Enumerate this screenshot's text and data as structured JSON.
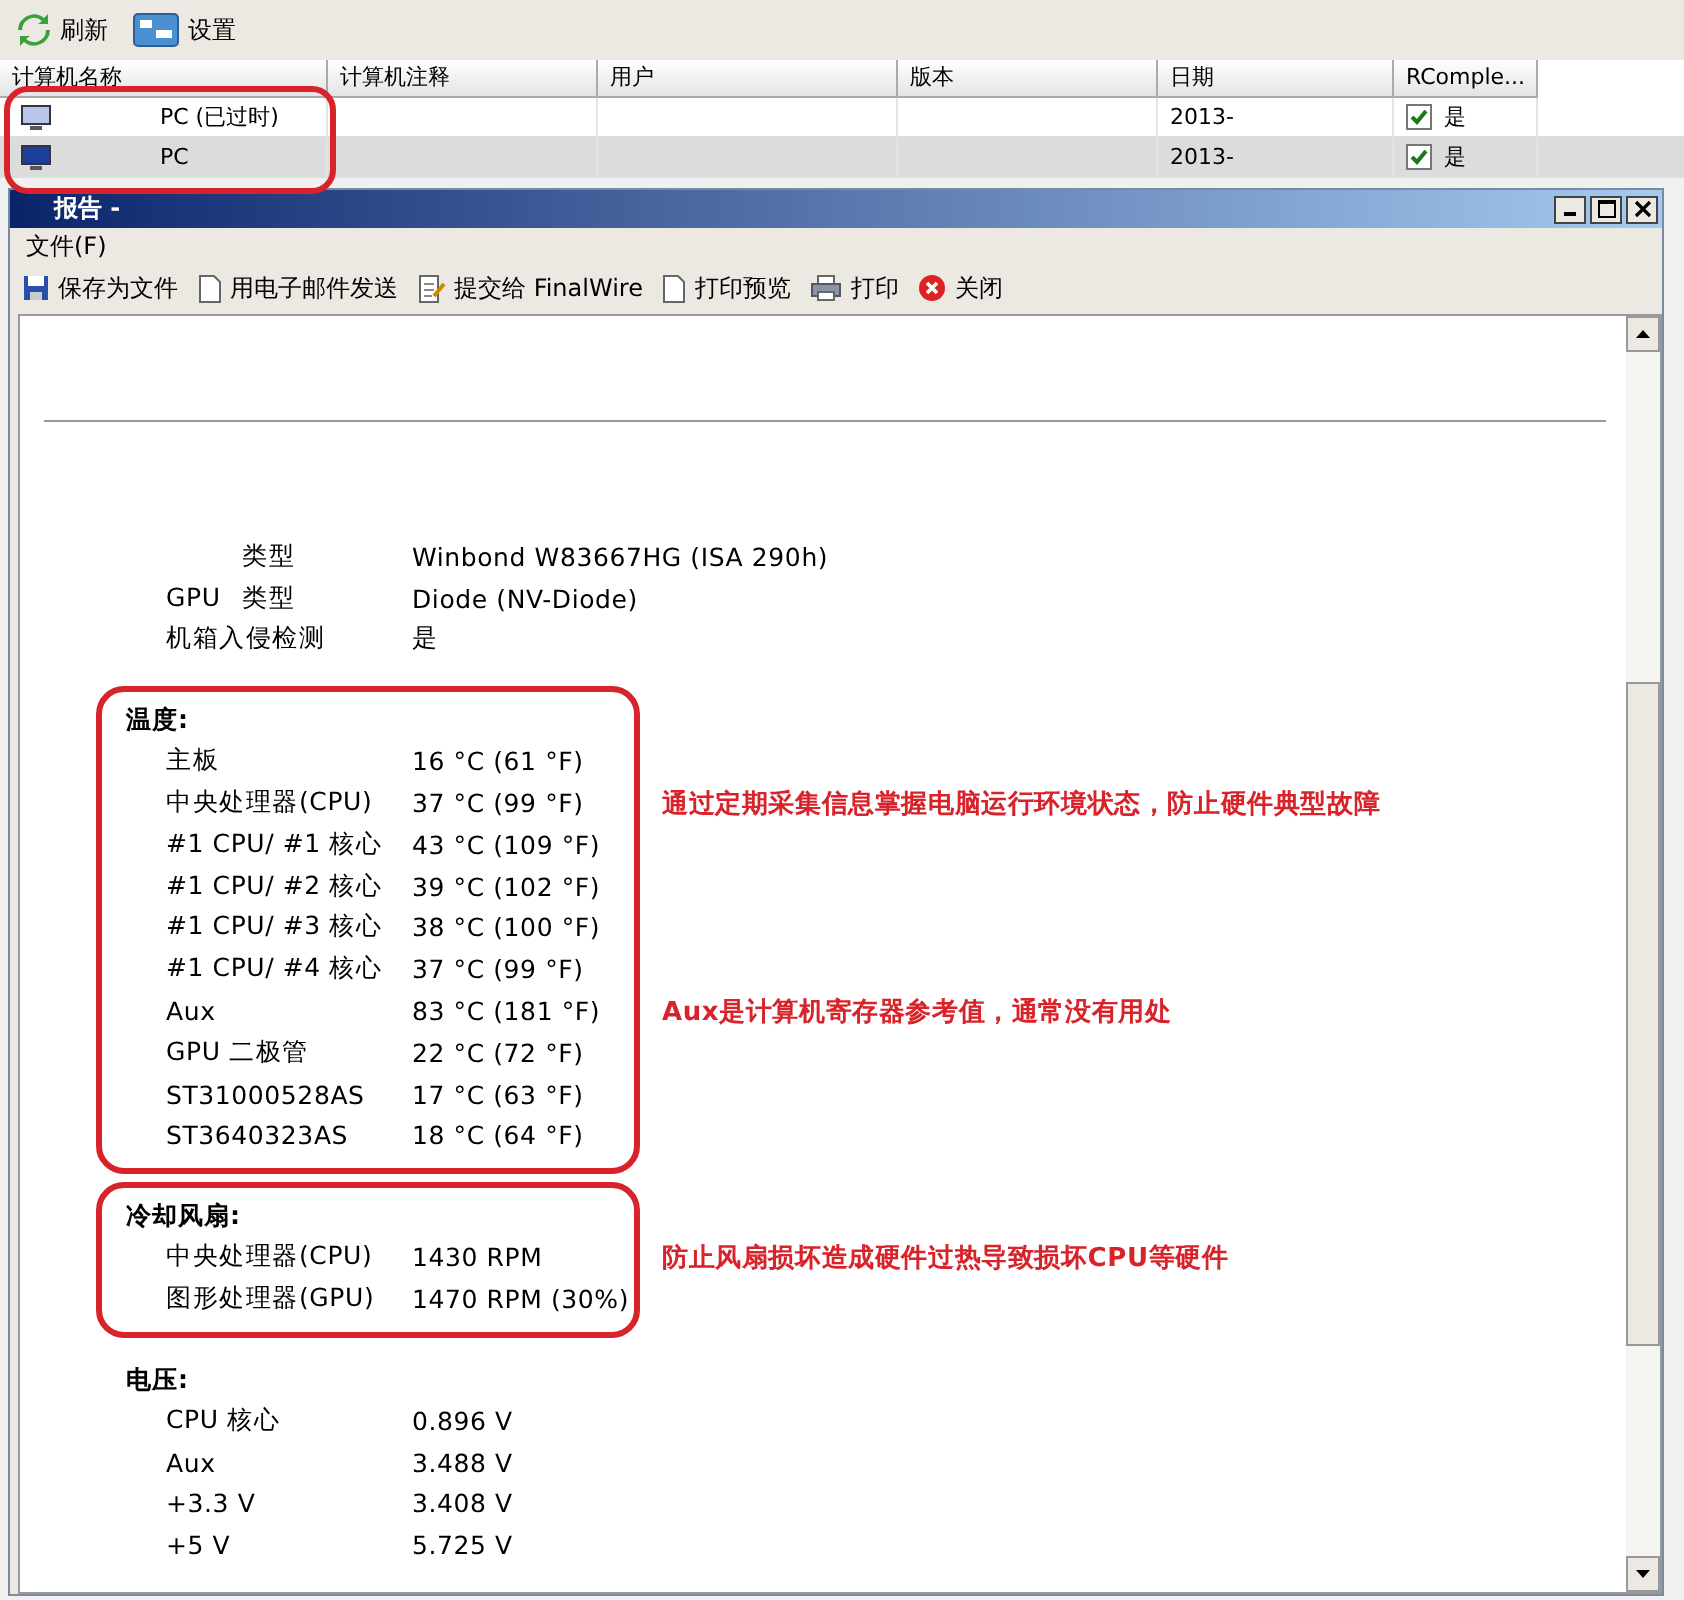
{
  "toolbar": [
    {
      "label": "刷新"
    },
    {
      "label": "设置"
    }
  ],
  "table": {
    "columns": [
      "计算机名称",
      "计算机注释",
      "用户",
      "版本",
      "日期",
      "RComple..."
    ],
    "rows": [
      {
        "name": "PC (已过时)",
        "date": "2013-",
        "checked": true,
        "flag": "是",
        "selected": false,
        "outdated": true
      },
      {
        "name": "PC",
        "date": "2013-",
        "checked": true,
        "flag": "是",
        "selected": true,
        "outdated": false
      }
    ],
    "annotated": true
  },
  "report": {
    "title": "报告 -",
    "menu": [
      "文件(F)"
    ],
    "actions": [
      {
        "label": "保存为文件"
      },
      {
        "label": "用电子邮件发送"
      },
      {
        "label": "提交给 FinalWire"
      },
      {
        "label": "打印预览"
      },
      {
        "label": "打印"
      },
      {
        "label": "关闭"
      }
    ],
    "sections": [
      {
        "rows": [
          {
            "kind": "sub",
            "label": "类型",
            "value": "Winbond W83667HG (ISA 290h)"
          },
          {
            "kind": "sub",
            "prefix": "GPU",
            "label": "类型",
            "value": "Diode (NV-Diode)"
          },
          {
            "kind": "plain",
            "label": "机箱入侵检测",
            "value": "是"
          }
        ]
      },
      {
        "title": "温度:",
        "annotated": true,
        "rows": [
          {
            "kind": "plain",
            "label": "主板",
            "value": "16 °C (61 °F)"
          },
          {
            "kind": "plain",
            "label": "中央处理器(CPU)",
            "value": "37 °C (99 °F)",
            "note": "通过定期采集信息掌握电脑运行环境状态，防止硬件典型故障"
          },
          {
            "kind": "plain",
            "label": "#1 CPU/ #1 核心",
            "value": "43 °C (109 °F)"
          },
          {
            "kind": "plain",
            "label": "#1 CPU/ #2 核心",
            "value": "39 °C (102 °F)"
          },
          {
            "kind": "plain",
            "label": "#1 CPU/ #3 核心",
            "value": "38 °C (100 °F)"
          },
          {
            "kind": "plain",
            "label": "#1 CPU/ #4 核心",
            "value": "37 °C (99 °F)"
          },
          {
            "kind": "plain",
            "label": "Aux",
            "value": "83 °C (181 °F)",
            "note": "Aux是计算机寄存器参考值，通常没有用处"
          },
          {
            "kind": "plain",
            "label": "GPU 二极管",
            "value": "22 °C (72 °F)"
          },
          {
            "kind": "plain",
            "label": "ST31000528AS",
            "value": "17 °C (63 °F)"
          },
          {
            "kind": "plain",
            "label": "ST3640323AS",
            "value": "18 °C (64 °F)"
          }
        ]
      },
      {
        "title": "冷却风扇:",
        "annotated": true,
        "rows": [
          {
            "kind": "plain",
            "label": "中央处理器(CPU)",
            "value": "1430 RPM",
            "note": "防止风扇损坏造成硬件过热导致损坏CPU等硬件"
          },
          {
            "kind": "plain",
            "label": "图形处理器(GPU)",
            "value": "1470 RPM (30%)"
          }
        ]
      },
      {
        "title": "电压:",
        "rows": [
          {
            "kind": "plain",
            "label": "CPU 核心",
            "value": "0.896 V"
          },
          {
            "kind": "plain",
            "label": "Aux",
            "value": "3.488 V"
          },
          {
            "kind": "plain",
            "label": "+3.3 V",
            "value": "3.408 V"
          },
          {
            "kind": "plain",
            "label": "+5 V",
            "value": "5.725 V"
          }
        ]
      }
    ]
  }
}
